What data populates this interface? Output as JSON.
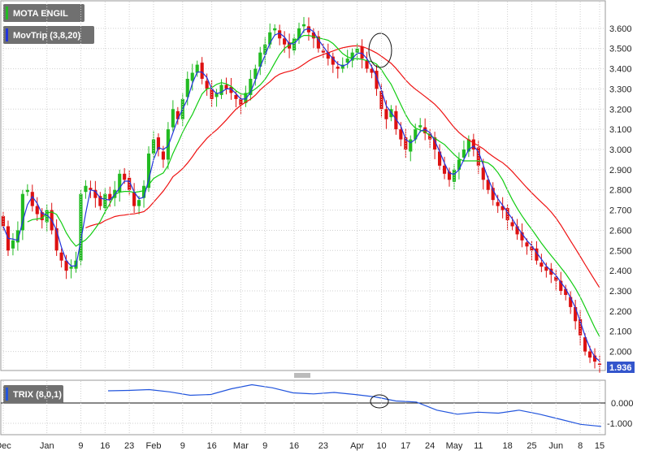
{
  "chart_data": {
    "type": "candlestick",
    "title": "MOTA ENGIL",
    "indicator_label": "MovTrip (3,8,20)",
    "last_price": "1.936",
    "colors": {
      "up": "#22bb22",
      "down": "#dd1111",
      "ma_fast": "#2233dd",
      "ma_mid": "#11cc11",
      "ma_slow": "#ee1111",
      "trix": "#2255dd",
      "price_tag": "#3355cc"
    },
    "price_axis": {
      "ticks": [
        "2.000",
        "2.100",
        "2.200",
        "2.300",
        "2.400",
        "2.500",
        "2.600",
        "2.700",
        "2.800",
        "2.900",
        "3.000",
        "3.100",
        "3.200",
        "3.300",
        "3.400",
        "3.500",
        "3.600"
      ],
      "range": [
        1.93,
        3.7
      ]
    },
    "x_labels": [
      "Dec",
      "Jan",
      "9",
      "16",
      "23",
      "Feb",
      "9",
      "16",
      "Mar",
      "9",
      "16",
      "23",
      "Apr",
      "10",
      "17",
      "24",
      "May",
      "11",
      "18",
      "25",
      "Jun",
      "8",
      "15"
    ],
    "x_label_index": [
      0,
      9,
      16,
      21,
      26,
      31,
      37,
      43,
      49,
      54,
      60,
      66,
      73,
      78,
      83,
      88,
      93,
      98,
      104,
      109,
      114,
      119,
      123
    ],
    "closes": [
      2.62,
      2.5,
      2.55,
      2.6,
      2.78,
      2.8,
      2.72,
      2.68,
      2.65,
      2.7,
      2.6,
      2.5,
      2.45,
      2.4,
      2.42,
      2.45,
      2.78,
      2.82,
      2.8,
      2.76,
      2.72,
      2.78,
      2.75,
      2.8,
      2.88,
      2.85,
      2.8,
      2.72,
      2.75,
      2.82,
      2.98,
      3.05,
      3.0,
      2.95,
      3.1,
      3.2,
      3.15,
      3.25,
      3.35,
      3.38,
      3.42,
      3.35,
      3.3,
      3.25,
      3.28,
      3.32,
      3.3,
      3.28,
      3.25,
      3.22,
      3.28,
      3.35,
      3.4,
      3.48,
      3.52,
      3.58,
      3.6,
      3.55,
      3.52,
      3.5,
      3.55,
      3.6,
      3.62,
      3.58,
      3.55,
      3.5,
      3.48,
      3.45,
      3.42,
      3.4,
      3.42,
      3.45,
      3.48,
      3.5,
      3.45,
      3.4,
      3.38,
      3.3,
      3.2,
      3.15,
      3.2,
      3.1,
      3.05,
      3.0,
      3.05,
      3.1,
      3.12,
      3.08,
      3.05,
      3.0,
      2.92,
      2.88,
      2.85,
      2.9,
      2.95,
      3.0,
      3.05,
      3.0,
      2.92,
      2.85,
      2.8,
      2.75,
      2.72,
      2.7,
      2.65,
      2.62,
      2.58,
      2.55,
      2.52,
      2.5,
      2.45,
      2.42,
      2.4,
      2.38,
      2.35,
      2.3,
      2.28,
      2.22,
      2.15,
      2.08,
      2.0,
      1.97,
      1.95,
      1.936
    ],
    "trix_axis": {
      "ticks": [
        "0.000",
        "-1.000"
      ]
    },
    "trix_values": [
      0.6,
      0.62,
      0.66,
      0.55,
      0.38,
      0.42,
      0.7,
      0.9,
      0.75,
      0.5,
      0.45,
      0.52,
      0.42,
      0.3,
      0.1,
      0.05,
      -0.35,
      -0.55,
      -0.45,
      -0.5,
      -0.35,
      -0.55,
      -0.8,
      -1.05,
      -1.15
    ],
    "trix_label": "TRIX (8,0,1)"
  }
}
